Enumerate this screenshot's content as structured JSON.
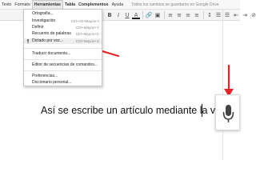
{
  "menubar": {
    "items": [
      "Texto",
      "Formato",
      "Herramientas",
      "Tabla",
      "Complementos",
      "Ayuda"
    ],
    "saved_status": "Todos los cambios se guardaron en Google Drive"
  },
  "toolbar": {
    "bold": "B",
    "italic": "I",
    "underline": "U",
    "text_color": "A"
  },
  "dropdown": {
    "items": [
      {
        "label": "Ortografía...",
        "shortcut": ""
      },
      {
        "label": "Investigación",
        "shortcut": "Ctrl+Alt+Mayús+I"
      },
      {
        "label": "Definir",
        "shortcut": "Ctrl+Mayús+Y"
      },
      {
        "label": "Recuento de palabras",
        "shortcut": "Ctrl+Mayús+C"
      },
      {
        "label": "Dictado por voz...",
        "shortcut": "Ctrl+Mayús+S"
      },
      {
        "label": "Traducir documento...",
        "shortcut": ""
      },
      {
        "label": "Editor de secuencias de comandos...",
        "shortcut": ""
      },
      {
        "label": "Preferencias...",
        "shortcut": ""
      },
      {
        "label": "Diccionario personal...",
        "shortcut": ""
      }
    ]
  },
  "document": {
    "text": "Así se escribe un artículo mediante la voz"
  },
  "colors": {
    "arrow": "#e0262a",
    "highlight": "#eeeeee",
    "mic": "#444444"
  },
  "icons": {
    "dictation": "microphone-icon",
    "voice_panel": "microphone-icon"
  }
}
